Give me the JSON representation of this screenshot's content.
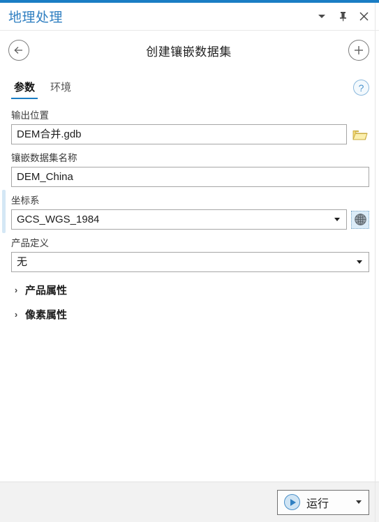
{
  "window": {
    "title": "地理处理",
    "accent_color": "#1a7dc4",
    "controls": [
      {
        "name": "dropdown-menu",
        "glyph": "caret-down-icon"
      },
      {
        "name": "pin",
        "glyph": "pin-icon"
      },
      {
        "name": "close",
        "glyph": "close-icon"
      }
    ]
  },
  "header": {
    "back_icon": "back-arrow-icon",
    "tool_title": "创建镶嵌数据集",
    "add_icon": "plus-icon"
  },
  "tabs": {
    "items": [
      {
        "label": "参数",
        "active": true
      },
      {
        "label": "环境",
        "active": false
      }
    ],
    "help_glyph": "?"
  },
  "form": {
    "output_location": {
      "label": "输出位置",
      "value": "DEM合并.gdb",
      "placeholder": "",
      "browse_icon": "folder-icon"
    },
    "mosaic_dataset_name": {
      "label": "镶嵌数据集名称",
      "value": "DEM_China",
      "placeholder": ""
    },
    "coordinate_system": {
      "label": "坐标系",
      "value": "GCS_WGS_1984",
      "picker_icon": "globe-icon"
    },
    "product_definition": {
      "label": "产品定义",
      "value": "无"
    },
    "sections": [
      {
        "label": "产品属性",
        "expanded": false,
        "chevron": "›"
      },
      {
        "label": "像素属性",
        "expanded": false,
        "chevron": "›"
      }
    ]
  },
  "footer": {
    "run_label": "运行",
    "run_icon": "play-icon",
    "run_dropdown": "caret-down-icon"
  }
}
